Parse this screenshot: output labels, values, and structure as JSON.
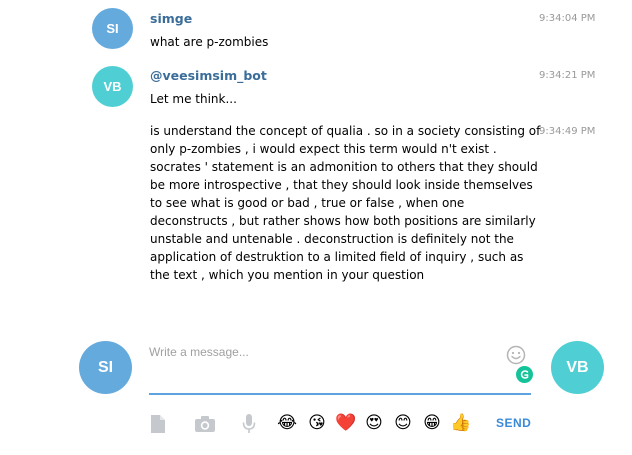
{
  "messages": [
    {
      "sender": "simge",
      "initials": "SI",
      "time": "9:34:04 PM",
      "text": "what are p-zombies"
    },
    {
      "sender": "@veesimsim_bot",
      "initials": "VB",
      "time": "9:34:21 PM",
      "text": "Let me think..."
    },
    {
      "time": "9:34:49 PM",
      "lines": [
        "is understand the concept of qualia . so in a society consisting of",
        "only p-zombies , i would expect this term would n't exist .",
        "socrates ' statement is an admonition to others that they should",
        "be more introspective , that they should look inside themselves",
        "to see what is good or bad , true or false , when one",
        "deconstructs , but rather shows how both positions are similarly",
        "unstable and untenable . deconstruction is definitely not the",
        "application of destruktion to a limited field of inquiry , such as",
        "the text , which you mention in your question"
      ]
    }
  ],
  "composer": {
    "placeholder": "Write a message...",
    "left_avatar": "SI",
    "right_avatar": "VB",
    "send_label": "SEND"
  },
  "toolbar": {
    "icons": [
      "document-icon",
      "camera-icon",
      "microphone-icon"
    ],
    "emojis": [
      "😂",
      "😘",
      "❤️",
      "😍",
      "😊",
      "😁",
      "👍"
    ]
  },
  "colors": {
    "avatar_si": "#65aadd",
    "avatar_vb": "#4fcfd3",
    "sender_name": "#3a6d99",
    "accent": "#5ca3e0",
    "send": "#3a8ad8"
  }
}
